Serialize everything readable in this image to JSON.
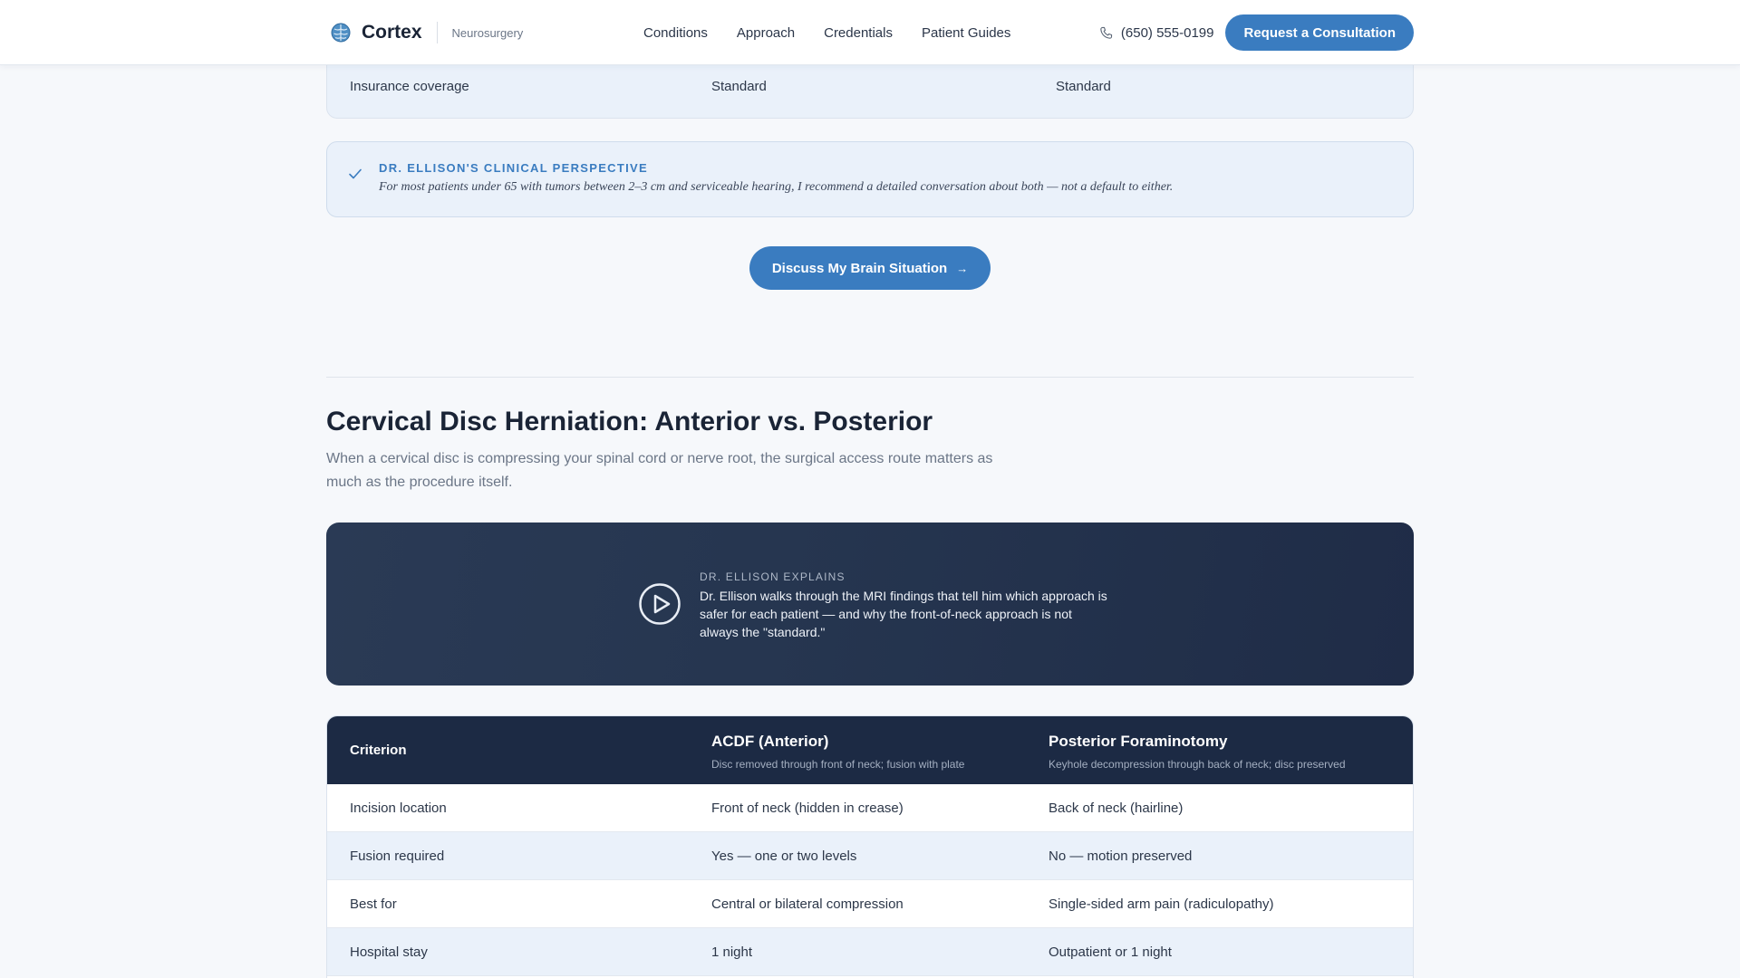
{
  "nav": {
    "brand": "Cortex",
    "brand_sub": "Neurosurgery",
    "links": [
      "Conditions",
      "Approach",
      "Credentials",
      "Patient Guides"
    ],
    "phone": "(650) 555-0199",
    "cta": "Request a Consultation"
  },
  "prev_table": {
    "row": [
      "Insurance coverage",
      "Standard",
      "Standard"
    ]
  },
  "perspective": {
    "title": "DR. ELLISON'S CLINICAL PERSPECTIVE",
    "text": "For most patients under 65 with tumors between 2–3 cm and serviceable hearing, I recommend a detailed conversation about both — not a default to either."
  },
  "discuss_button": {
    "label": "Discuss My Brain Situation",
    "arrow": "→"
  },
  "section": {
    "title": "Cervical Disc Herniation: Anterior vs. Posterior",
    "description": "When a cervical disc is compressing your spinal cord or nerve root, the surgical access route matters as much as the procedure itself."
  },
  "video": {
    "label": "DR. ELLISON EXPLAINS",
    "text": "Dr. Ellison walks through the MRI findings that tell him which approach is safer for each patient — and why the front-of-neck approach is not always the \"standard.\""
  },
  "table": {
    "criterion_header": "Criterion",
    "columns": [
      {
        "name": "ACDF (Anterior)",
        "sub": "Disc removed through front of neck; fusion with plate"
      },
      {
        "name": "Posterior Foraminotomy",
        "sub": "Keyhole decompression through back of neck; disc preserved"
      }
    ],
    "rows": [
      [
        "Incision location",
        "Front of neck (hidden in crease)",
        "Back of neck (hairline)"
      ],
      [
        "Fusion required",
        "Yes — one or two levels",
        "No — motion preserved"
      ],
      [
        "Best for",
        "Central or bilateral compression",
        "Single-sided arm pain (radiculopathy)"
      ],
      [
        "Hospital stay",
        "1 night",
        "Outpatient or 1 night"
      ]
    ]
  },
  "colors": {
    "accent": "#3a7cc0",
    "navy": "#1c2a44",
    "row_alt": "#eaf1fa"
  },
  "icons": [
    "brain-logo-icon",
    "phone-icon",
    "check-icon",
    "play-icon"
  ]
}
